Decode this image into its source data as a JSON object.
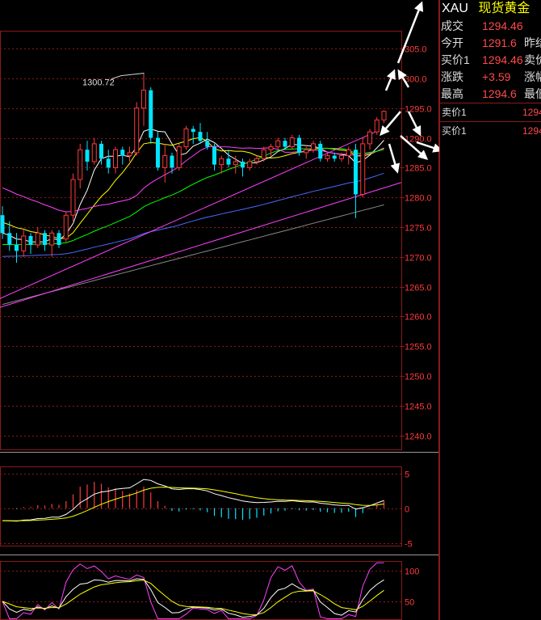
{
  "quote": {
    "symbol": "XAU",
    "name": "现货黄金",
    "rows": [
      {
        "label": "成交",
        "value": "1294.46",
        "label2": ""
      },
      {
        "label": "今开",
        "value": "1291.6",
        "label2": "昨结"
      },
      {
        "label": "买价1",
        "value": "1294.46",
        "label2": "卖价"
      },
      {
        "label": "涨跌",
        "value": "+3.59",
        "label2": "涨幅"
      },
      {
        "label": "最高",
        "value": "1294.6",
        "label2": "最低"
      }
    ],
    "book": [
      {
        "label": "卖价1",
        "value": "1294"
      },
      {
        "label": "买价1",
        "value": "1294"
      }
    ],
    "up_color": "#ff4a4a"
  },
  "chart_data": {
    "type": "candlestick",
    "colors": {
      "up": "#ff3a3a",
      "down": "#00e5ff",
      "grid": "#8a1a1a",
      "ma5": "#ffffff",
      "ma10": "#ffff00",
      "ma20": "#ff40ff",
      "ma30": "#00ff00",
      "ma60": "#4a6aff",
      "ma120": "#888888",
      "trend": "#ff40ff"
    },
    "price_panel": {
      "ylim": [
        1237.5,
        1308.0
      ],
      "ticks": [
        1305.0,
        1300.0,
        1295.0,
        1290.0,
        1285.0,
        1280.0,
        1275.0,
        1270.0,
        1265.0,
        1260.0,
        1255.0,
        1250.0,
        1245.0,
        1240.0
      ],
      "tick_labels": [
        "305.0",
        "300.0",
        "1295.0",
        "1290.0",
        "1285.0",
        "1280.0",
        "1275.0",
        "1270.0",
        "1265.0",
        "1260.0",
        "1255.0",
        "1250.0",
        "1245.0",
        "1240.0"
      ],
      "annotation": {
        "text": "1300.72",
        "value": 1300.72,
        "index": 20
      }
    },
    "candles": [
      [
        1277.0,
        1278.5,
        1273.0,
        1274.0
      ],
      [
        1274.0,
        1276.0,
        1271.0,
        1272.0
      ],
      [
        1272.0,
        1274.0,
        1269.0,
        1271.0
      ],
      [
        1271.0,
        1274.5,
        1270.0,
        1273.5
      ],
      [
        1273.5,
        1274.0,
        1270.5,
        1272.0
      ],
      [
        1272.0,
        1275.0,
        1271.5,
        1274.0
      ],
      [
        1274.0,
        1274.5,
        1271.0,
        1272.0
      ],
      [
        1272.0,
        1274.5,
        1270.0,
        1274.0
      ],
      [
        1274.0,
        1274.5,
        1271.5,
        1272.0
      ],
      [
        1273.0,
        1277.5,
        1272.5,
        1277.0
      ],
      [
        1277.0,
        1284.0,
        1276.0,
        1283.0
      ],
      [
        1283.0,
        1289.0,
        1281.5,
        1288.0
      ],
      [
        1288.0,
        1289.5,
        1284.5,
        1286.0
      ],
      [
        1286.0,
        1290.0,
        1285.5,
        1289.0
      ],
      [
        1289.0,
        1289.5,
        1285.5,
        1286.5
      ],
      [
        1286.5,
        1288.0,
        1284.0,
        1285.0
      ],
      [
        1285.0,
        1288.5,
        1284.0,
        1288.0
      ],
      [
        1288.0,
        1288.5,
        1285.5,
        1287.0
      ],
      [
        1287.0,
        1288.5,
        1286.0,
        1287.5
      ],
      [
        1287.5,
        1296.0,
        1287.0,
        1295.0
      ],
      [
        1295.0,
        1300.7,
        1292.0,
        1298.0
      ],
      [
        1298.0,
        1298.5,
        1289.0,
        1290.0
      ],
      [
        1290.0,
        1291.0,
        1284.5,
        1285.0
      ],
      [
        1285.0,
        1289.0,
        1282.5,
        1287.0
      ],
      [
        1287.0,
        1287.5,
        1284.0,
        1285.0
      ],
      [
        1285.0,
        1289.0,
        1284.5,
        1288.5
      ],
      [
        1288.5,
        1292.0,
        1288.0,
        1291.5
      ],
      [
        1291.5,
        1292.0,
        1289.0,
        1291.0
      ],
      [
        1291.0,
        1292.5,
        1289.0,
        1289.5
      ],
      [
        1289.5,
        1291.0,
        1288.0,
        1288.5
      ],
      [
        1288.5,
        1289.0,
        1284.5,
        1285.5
      ],
      [
        1285.5,
        1287.0,
        1284.0,
        1286.5
      ],
      [
        1286.5,
        1288.0,
        1285.0,
        1285.5
      ],
      [
        1285.5,
        1287.0,
        1284.0,
        1286.0
      ],
      [
        1286.0,
        1286.5,
        1283.5,
        1285.0
      ],
      [
        1285.0,
        1286.5,
        1284.5,
        1286.0
      ],
      [
        1286.0,
        1287.0,
        1285.5,
        1286.5
      ],
      [
        1286.5,
        1288.5,
        1286.0,
        1288.0
      ],
      [
        1288.0,
        1289.0,
        1287.0,
        1288.5
      ],
      [
        1288.5,
        1290.0,
        1288.0,
        1289.5
      ],
      [
        1289.5,
        1290.0,
        1288.0,
        1288.5
      ],
      [
        1288.5,
        1290.5,
        1288.0,
        1290.0
      ],
      [
        1290.0,
        1290.5,
        1287.0,
        1287.5
      ],
      [
        1287.5,
        1288.5,
        1286.5,
        1288.0
      ],
      [
        1288.0,
        1289.5,
        1287.5,
        1289.0
      ],
      [
        1289.0,
        1289.5,
        1286.0,
        1286.5
      ],
      [
        1286.5,
        1287.5,
        1286.0,
        1287.0
      ],
      [
        1287.0,
        1287.5,
        1286.0,
        1286.5
      ],
      [
        1286.5,
        1287.5,
        1286.0,
        1287.0
      ],
      [
        1287.0,
        1288.5,
        1285.5,
        1288.0
      ],
      [
        1288.0,
        1289.0,
        1276.5,
        1280.5
      ],
      [
        1280.5,
        1290.0,
        1280.0,
        1289.0
      ],
      [
        1289.0,
        1291.5,
        1288.0,
        1291.0
      ],
      [
        1291.0,
        1293.5,
        1290.5,
        1293.0
      ],
      [
        1293.0,
        1294.6,
        1292.5,
        1294.46
      ]
    ],
    "macd_panel": {
      "ylim": [
        -5.5,
        6
      ],
      "ticks": [
        5,
        0,
        -5
      ],
      "tick_labels": [
        "5",
        "0",
        "-5"
      ]
    },
    "kdj_panel": {
      "ylim": [
        20,
        115
      ],
      "ticks": [
        100,
        50
      ],
      "tick_labels": [
        "100",
        "50"
      ]
    }
  }
}
